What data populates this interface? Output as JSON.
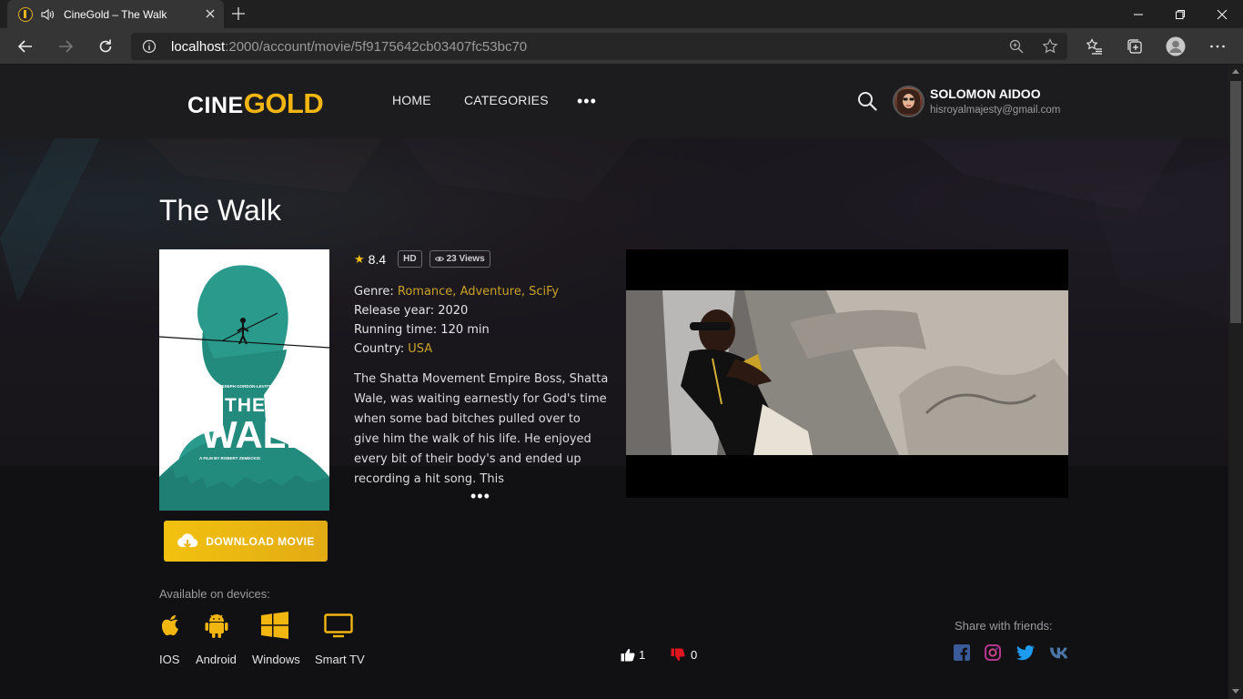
{
  "browser": {
    "tab_title": "CineGold – The Walk",
    "url_host": "localhost",
    "url_path": ":2000/account/movie/5f9175642cb03407fc53bc70"
  },
  "header": {
    "logo_part1": "CINE",
    "logo_part2": "GOLD",
    "nav": [
      "HOME",
      "CATEGORIES"
    ],
    "more": "•••",
    "user_name": "SOLOMON AIDOO",
    "user_email": "hisroyalmajesty@gmail.com"
  },
  "movie": {
    "title": "The Walk",
    "rating": "8.4",
    "quality": "HD",
    "views": "23 Views",
    "genre_label": "Genre:",
    "genre_value": "Romance, Adventure, SciFy",
    "year_label": "Release year:",
    "year_value": "2020",
    "runtime_label": "Running time:",
    "runtime_value": "120 min",
    "country_label": "Country:",
    "country_value": "USA",
    "description": "The Shatta Movement Empire Boss, Shatta Wale, was waiting earnestly for God's time when some bad bitches pulled over to give him the walk of his life. He enjoyed every bit of their body's and ended up recording a hit song. This",
    "description_more": "•••",
    "poster_text": {
      "small": "JOSEPH GORDON-LEVITT",
      "line1": "THE",
      "line2": "WALK",
      "credit": "A FILM BY ROBERT ZEMECKIS"
    }
  },
  "download": {
    "label": "DOWNLOAD MOVIE"
  },
  "devices": {
    "label": "Available on devices:",
    "items": [
      "IOS",
      "Android",
      "Windows",
      "Smart TV"
    ]
  },
  "votes": {
    "likes": "1",
    "dislikes": "0"
  },
  "share": {
    "label": "Share with friends:",
    "networks": [
      "facebook",
      "instagram",
      "twitter",
      "vk"
    ]
  },
  "colors": {
    "accent_gold": "#f2b611",
    "background": "#101012",
    "header_bg": "#1c1c1e"
  }
}
